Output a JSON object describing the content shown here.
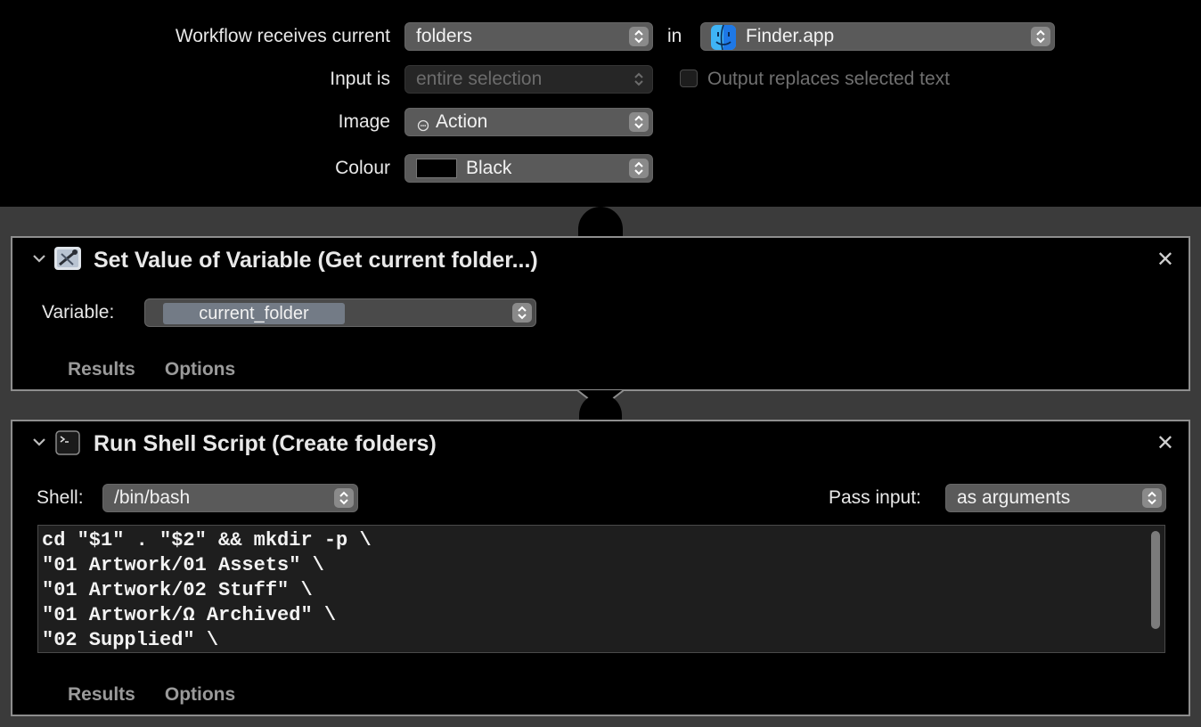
{
  "header": {
    "receives_label": "Workflow receives current",
    "receives_value": "folders",
    "in_label": "in",
    "app_value": "Finder.app",
    "input_label": "Input is",
    "input_value": "entire selection",
    "output_checkbox_label": "Output replaces selected text",
    "output_checked": false,
    "image_label": "Image",
    "image_value": "Action",
    "colour_label": "Colour",
    "colour_value": "Black",
    "colour_swatch": "#000000"
  },
  "actions": [
    {
      "title": "Set Value of Variable (Get current folder...)",
      "variable_label": "Variable:",
      "variable_value": "current_folder",
      "tabs": [
        "Results",
        "Options"
      ]
    },
    {
      "title": "Run Shell Script (Create folders)",
      "shell_label": "Shell:",
      "shell_value": "/bin/bash",
      "pass_input_label": "Pass input:",
      "pass_input_value": "as arguments",
      "script_lines": [
        "cd \"$1\" . \"$2\" && mkdir -p \\",
        "\"01 Artwork/01 Assets\" \\",
        "\"01 Artwork/02 Stuff\" \\",
        "\"01 Artwork/Ω Archived\" \\",
        "\"02 Supplied\" \\"
      ],
      "tabs": [
        "Results",
        "Options"
      ]
    }
  ],
  "colors": {
    "background": "#000000",
    "workarea": "#3b3b3b",
    "popup": "#5a5a5a",
    "action_border": "#8e8e8e",
    "variable_chip": "#737b86"
  }
}
